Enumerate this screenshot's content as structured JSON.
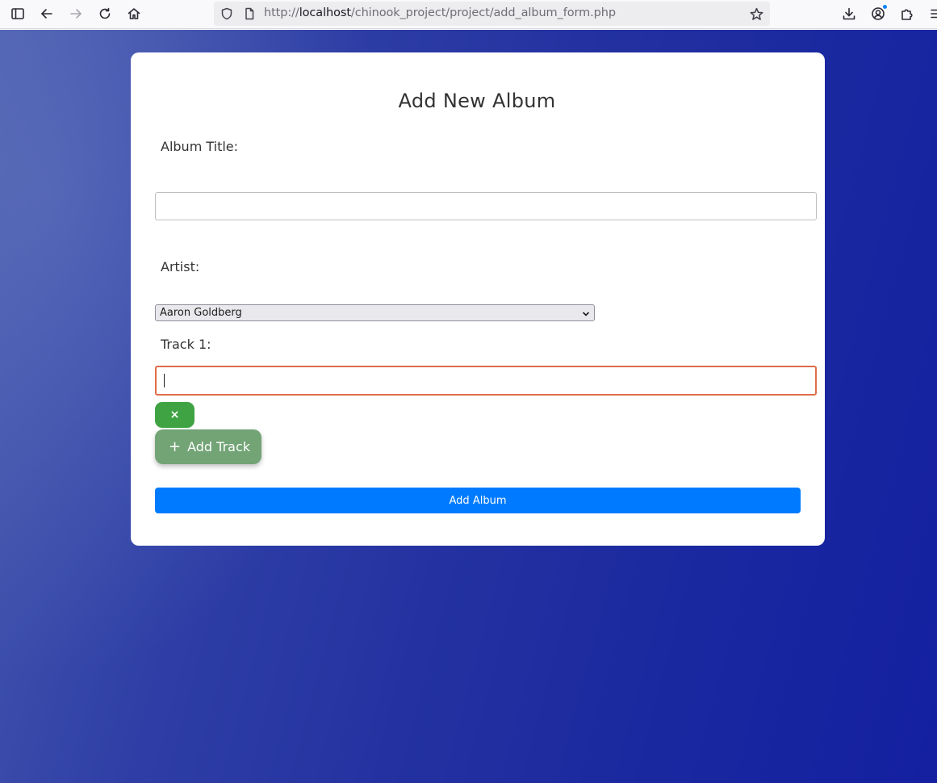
{
  "browser": {
    "url_prefix": "http://",
    "url_host": "localhost",
    "url_path": "/chinook_project/project/add_album_form.php",
    "icons": [
      "sidebar-icon",
      "back-icon",
      "forward-icon",
      "reload-icon",
      "home-icon",
      "shield-icon",
      "page-icon",
      "star-icon",
      "download-icon",
      "account-icon",
      "extensions-icon",
      "menu-icon"
    ]
  },
  "form": {
    "heading": "Add New Album",
    "album_title_label": "Album Title:",
    "album_title_value": "",
    "artist_label": "Artist:",
    "artist_selected": "Aaron Goldberg",
    "track_label": "Track 1:",
    "track_value": "",
    "remove_track_label": "×",
    "add_track_label": "Add Track",
    "add_track_icon": "+",
    "submit_label": "Add Album"
  },
  "colors": {
    "submit": "#007bff",
    "remove": "#3fa344",
    "add_track": "#72a476",
    "focus_border": "#e06c4a",
    "background": "#2230a0"
  }
}
